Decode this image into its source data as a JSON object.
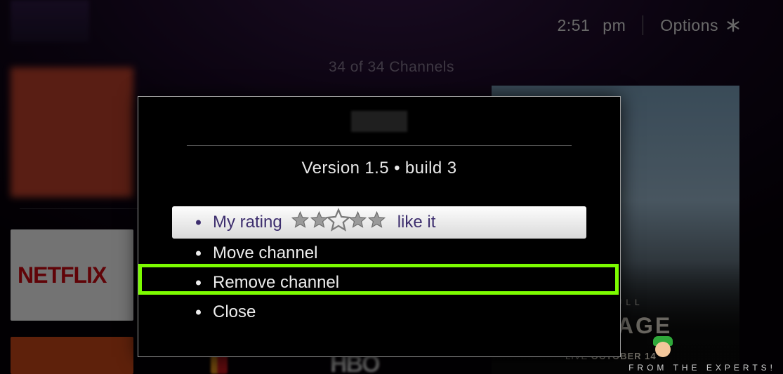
{
  "topbar": {
    "time": "2:51",
    "ampm": "pm",
    "options_label": "Options"
  },
  "channel_count": "34 of 34 Channels",
  "left_tiles": {
    "netflix_label": "NETFLIX"
  },
  "bottom_row": {
    "hbo_label": "HBO"
  },
  "promo": {
    "subtitle": "RED BULL",
    "title": "RAMPAGE",
    "footer_prefix": "LIVE ",
    "footer_bold": "OCTOBER 14"
  },
  "modal": {
    "version_text": "Version 1.5 • build 3",
    "menu": {
      "rating": {
        "label": "My rating",
        "suffix": "like it"
      },
      "move": {
        "label": "Move channel"
      },
      "remove": {
        "label": "Remove channel"
      },
      "close": {
        "label": "Close"
      }
    }
  },
  "watermark": {
    "text": "FROM THE EXPERTS!"
  }
}
